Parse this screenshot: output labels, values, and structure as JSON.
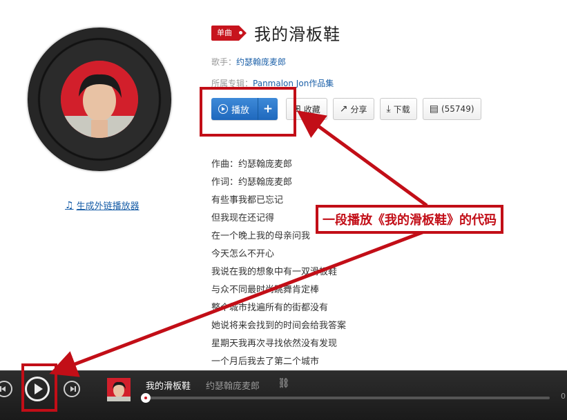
{
  "song": {
    "tag": "单曲",
    "title": "我的滑板鞋",
    "singer_label": "歌手：",
    "singer": "约瑟翰庞麦郎",
    "album_label": "所属专辑：",
    "album": "Panmalon Jon作品集"
  },
  "actions": {
    "play": "播放",
    "plus": "+",
    "favorite": "收藏",
    "share": "分享",
    "download": "下载",
    "comments": "(55749)"
  },
  "generate_link": "生成外链播放器",
  "lyrics": [
    "作曲：约瑟翰庞麦郎",
    "作词：约瑟翰庞麦郎",
    "有些事我都已忘记",
    "但我现在还记得",
    "在一个晚上我的母亲问我",
    "今天怎么不开心",
    "我说在我的想象中有一双滑板鞋",
    "与众不同最时尚跳舞肯定棒",
    "整个城市找遍所有的街都没有",
    "她说将来会找到的时间会给我答案",
    "星期天我再次寻找依然没有发现",
    "一个月后我去了第二个城市"
  ],
  "annotation": "一段播放《我的滑板鞋》的代码",
  "player": {
    "title": "我的滑板鞋",
    "artist": "约瑟翰庞麦郎",
    "time": "0",
    "progress": 0.0
  },
  "colors": {
    "brand_red": "#c7141d",
    "accent_blue": "#1f68bd",
    "annotation_red": "#c20e17"
  }
}
